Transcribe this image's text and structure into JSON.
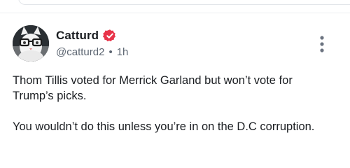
{
  "post": {
    "author": {
      "display_name": "Catturd",
      "handle": "@catturd2",
      "verified": true,
      "verified_color": "#e8344a",
      "avatar_icon": "cat-with-glasses-avatar"
    },
    "time_separator": "•",
    "timestamp": "1h",
    "more_icon": "vertical-ellipsis-icon",
    "paragraphs": [
      "Thom Tillis voted for Merrick Garland but won’t vote for Trump’s picks.",
      "You wouldn’t do this unless you’re in on the D.C corruption."
    ]
  },
  "colors": {
    "text_primary": "#1a1d21",
    "text_secondary": "#5b6470",
    "divider": "#eceef1"
  }
}
